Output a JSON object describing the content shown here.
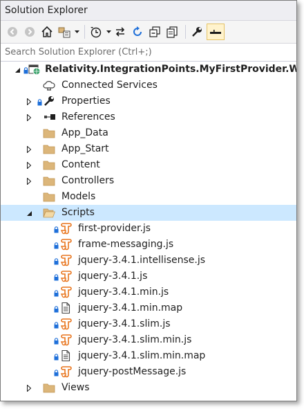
{
  "window": {
    "title": "Solution Explorer"
  },
  "toolbar": {
    "icons": [
      "back-icon",
      "forward-icon",
      "home-icon",
      "switch-views-icon",
      "chevron-down-icon",
      "pending-changes-filter-icon",
      "chevron-down-icon",
      "sync-icon",
      "refresh-icon",
      "collapse-all-icon",
      "show-all-files-icon",
      "properties-wrench-icon",
      "preview-selected-items-icon"
    ]
  },
  "search": {
    "placeholder": "Search Solution Explorer (Ctrl+;)"
  },
  "tree": {
    "project": "Relativity.IntegrationPoints.MyFirstProvider.Web",
    "items": [
      {
        "label": "Connected Services",
        "icon": "connected-services-icon"
      },
      {
        "label": "Properties",
        "icon": "wrench-icon"
      },
      {
        "label": "References",
        "icon": "references-icon"
      },
      {
        "label": "App_Data",
        "icon": "folder-icon"
      },
      {
        "label": "App_Start",
        "icon": "folder-icon"
      },
      {
        "label": "Content",
        "icon": "folder-icon"
      },
      {
        "label": "Controllers",
        "icon": "folder-icon"
      },
      {
        "label": "Models",
        "icon": "folder-icon"
      },
      {
        "label": "Scripts",
        "icon": "folder-open-icon"
      },
      {
        "label": "first-provider.js",
        "icon": "js-file-icon"
      },
      {
        "label": "frame-messaging.js",
        "icon": "js-file-icon"
      },
      {
        "label": "jquery-3.4.1.intellisense.js",
        "icon": "js-file-icon"
      },
      {
        "label": "jquery-3.4.1.js",
        "icon": "js-file-icon"
      },
      {
        "label": "jquery-3.4.1.min.js",
        "icon": "js-file-icon"
      },
      {
        "label": "jquery-3.4.1.min.map",
        "icon": "map-file-icon"
      },
      {
        "label": "jquery-3.4.1.slim.js",
        "icon": "js-file-icon"
      },
      {
        "label": "jquery-3.4.1.slim.min.js",
        "icon": "js-file-icon"
      },
      {
        "label": "jquery-3.4.1.slim.min.map",
        "icon": "map-file-icon"
      },
      {
        "label": "jquery-postMessage.js",
        "icon": "js-file-icon"
      },
      {
        "label": "Views",
        "icon": "folder-icon"
      }
    ]
  },
  "colors": {
    "selection": "#cce8ff",
    "folder": "#dcb67a",
    "js": "#e8741c",
    "lock": "#1e6fd9",
    "expander": "#1e1e1e"
  }
}
